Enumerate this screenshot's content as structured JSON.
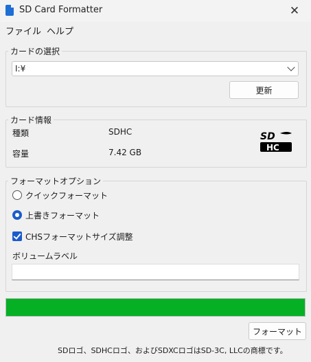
{
  "window": {
    "title": "SD Card Formatter",
    "close_glyph": "✕"
  },
  "menu": {
    "items": [
      "ファイル",
      "ヘルプ"
    ]
  },
  "card_select": {
    "legend": "カードの選択",
    "selected_drive": "I:¥",
    "refresh_label": "更新"
  },
  "card_info": {
    "legend": "カード情報",
    "type_label": "種類",
    "type_value": "SDHC",
    "capacity_label": "容量",
    "capacity_value": "7.42 GB",
    "logo_icon": "sdhc-logo"
  },
  "format_options": {
    "legend": "フォーマットオプション",
    "quick_format": {
      "label": "クイックフォーマット",
      "selected": false
    },
    "overwrite_format": {
      "label": "上書きフォーマット",
      "selected": true
    },
    "chs_adjust": {
      "label": "CHSフォーマットサイズ調整",
      "checked": true
    },
    "volume_label": {
      "label": "ボリュームラベル",
      "value": ""
    }
  },
  "progress": {
    "percent": 100,
    "color": "#06b025"
  },
  "actions": {
    "format_label": "フォーマット"
  },
  "footer": {
    "note": "SDロゴ、SDHCロゴ、およびSDXCロゴはSD-3C, LLCの商標です。"
  },
  "colors": {
    "accent": "#1a5ccc"
  }
}
